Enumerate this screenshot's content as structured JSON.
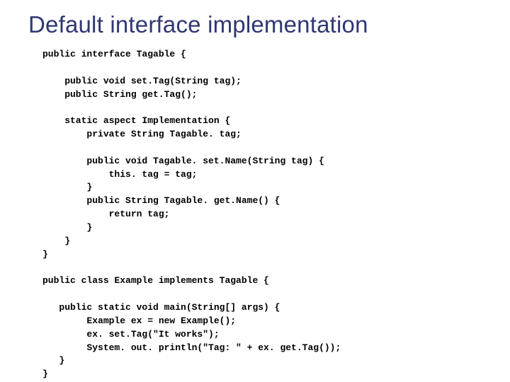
{
  "title": "Default interface implementation",
  "code": "public interface Tagable {\n\n    public void set.Tag(String tag);\n    public String get.Tag();\n\n    static aspect Implementation {\n        private String Tagable. tag;\n\n        public void Tagable. set.Name(String tag) {\n            this. tag = tag;\n        }\n        public String Tagable. get.Name() {\n            return tag;\n        }\n    }\n}\n\npublic class Example implements Tagable {\n\n   public static void main(String[] args) {\n        Example ex = new Example();\n        ex. set.Tag(\"It works\");\n        System. out. println(\"Tag: \" + ex. get.Tag());\n   }\n}"
}
